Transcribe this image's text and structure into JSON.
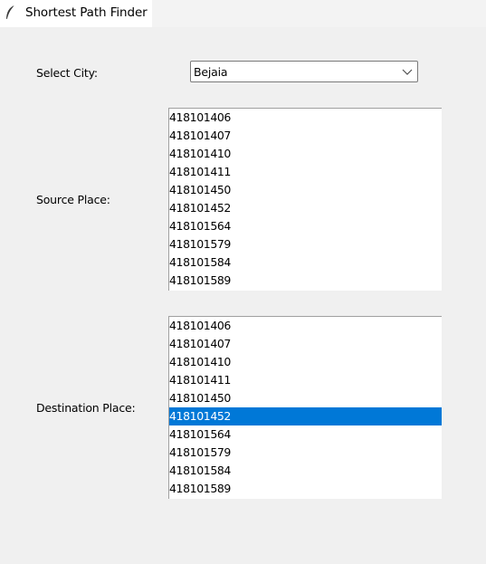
{
  "window": {
    "title": "Shortest Path Finder",
    "icon": "feather-icon"
  },
  "form": {
    "city_label": "Select City:",
    "city_value": "Bejaia",
    "source_label": "Source Place:",
    "destination_label": "Destination Place:"
  },
  "source_list": {
    "items": [
      "418101406",
      "418101407",
      "418101410",
      "418101411",
      "418101450",
      "418101452",
      "418101564",
      "418101579",
      "418101584",
      "418101589"
    ],
    "selected_index": null
  },
  "destination_list": {
    "items": [
      "418101406",
      "418101407",
      "418101410",
      "418101411",
      "418101450",
      "418101452",
      "418101564",
      "418101579",
      "418101584",
      "418101589"
    ],
    "selected_index": 5,
    "selected_value": "418101452"
  },
  "colors": {
    "background": "#f0f0f0",
    "selection": "#0078d7",
    "selection_text": "#ffffff"
  }
}
